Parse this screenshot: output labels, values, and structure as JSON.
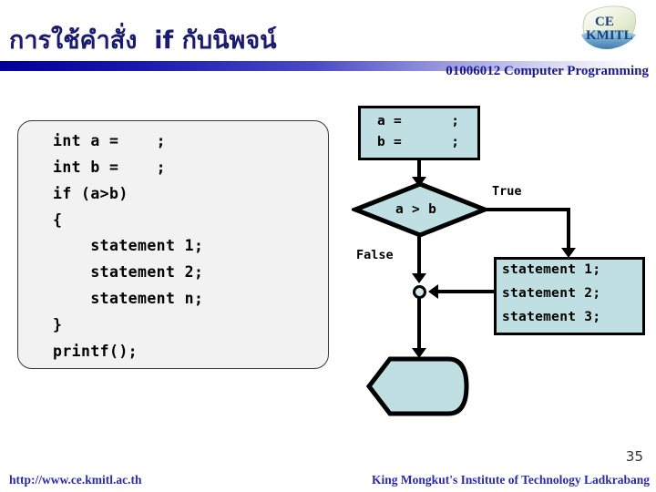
{
  "header": {
    "title": "การใช้คำสั่ง  if กับนิพจน์",
    "course": "01006012 Computer Programming",
    "logo_icon": "kmitl-ce-logo-icon",
    "gradient_start": "#00009a",
    "gradient_end": "#ffffff",
    "title_color": "#1a1a6e"
  },
  "code_panel": {
    "lines": [
      "int a =    ;",
      "int b =    ;",
      "if (a>b)",
      "{",
      "    statement 1;",
      "    statement 2;",
      "    statement n;",
      "}",
      "printf();"
    ],
    "background": "#f2f2f2",
    "border_color": "#3a3a3a"
  },
  "flowchart": {
    "fill_color": "#bfdfe2",
    "stroke_color": "#000000",
    "init_box": {
      "line1": "a =      ;",
      "line2": "b =      ;"
    },
    "decision": {
      "condition": "a > b",
      "true_label": "True",
      "false_label": "False"
    },
    "statement_box": {
      "line1": "statement 1;",
      "line2": "statement 2;",
      "line3": "statement 3;"
    },
    "output_shape": {
      "text": ""
    },
    "merge_node": "merge-connector"
  },
  "footer": {
    "url": "http://www.ce.kmitl.ac.th",
    "institute": "King Mongkut's Institute of Technology Ladkrabang",
    "page_number": "35",
    "text_color": "#2a2aa8"
  }
}
